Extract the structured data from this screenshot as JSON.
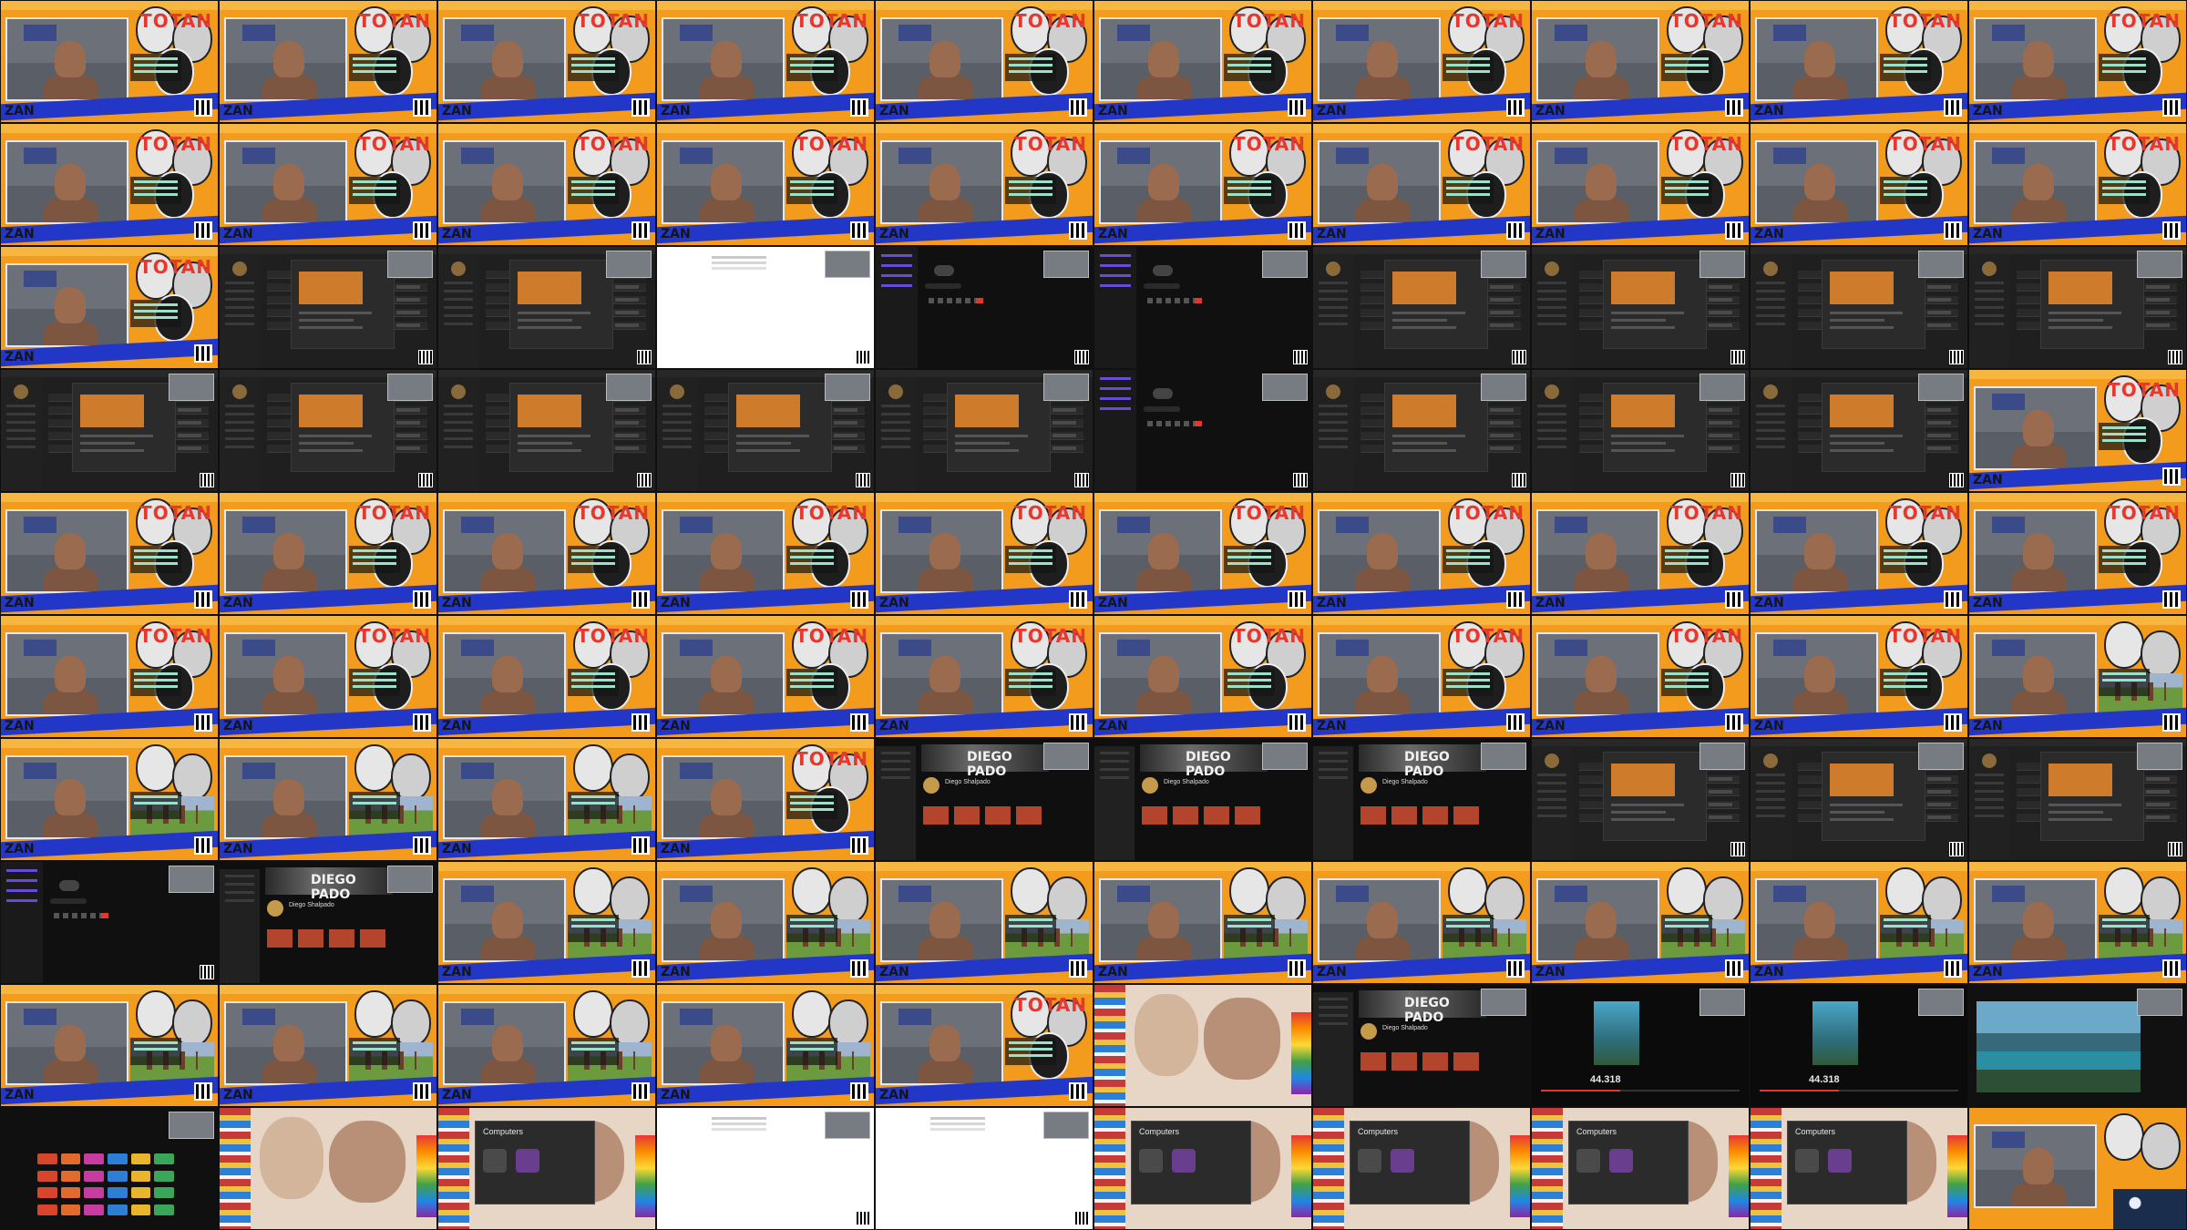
{
  "title": "",
  "tile_types": [
    "orange",
    "orange",
    "orange",
    "orange",
    "orange",
    "orange",
    "orange",
    "orange",
    "orange",
    "orange",
    "orange",
    "orange",
    "orange",
    "orange",
    "orange",
    "orange",
    "orange",
    "orange",
    "orange",
    "orange",
    "orange",
    "dark",
    "dark",
    "white",
    "call",
    "call",
    "dark",
    "dark",
    "dark",
    "dark",
    "dark",
    "dark",
    "dark",
    "dark",
    "dark",
    "call",
    "dark",
    "dark",
    "dark",
    "orange",
    "orange",
    "orange",
    "orange",
    "orange",
    "orange",
    "orange",
    "orange",
    "orange",
    "orange",
    "orange",
    "orange",
    "orange",
    "orange",
    "orange",
    "orange",
    "orange",
    "orange",
    "orange",
    "orange",
    "orange-field",
    "orange-field",
    "orange-field",
    "orange-field",
    "orange",
    "channel",
    "channel",
    "channel",
    "dark",
    "dark",
    "dark",
    "call",
    "channel",
    "orange-field",
    "orange-field",
    "orange-field",
    "orange-field",
    "orange-field",
    "orange-field",
    "orange-field",
    "orange-field",
    "orange-field",
    "orange-field",
    "orange-field",
    "orange-field",
    "orange",
    "desk",
    "channel",
    "phone",
    "phone",
    "land",
    "apps",
    "desk",
    "desk-dialog",
    "white",
    "white",
    "desk-dialog",
    "desk-dialog",
    "desk-dialog",
    "desk-dialog",
    "night"
  ],
  "orange_tile": {
    "title": "TOTAN",
    "name": "ZAN"
  },
  "channel_tile": {
    "banner": "DIEGO PADO",
    "name": "Diego Shalpado"
  },
  "phone_tile": {
    "count": "44.318"
  },
  "dialog_tile": {
    "title": "Computers"
  },
  "colors": {
    "orange_bg": "#f29b1d",
    "blue_wave": "#2236c8",
    "accent_red": "#e8372c",
    "dark_bg": "#1f1f1f"
  }
}
